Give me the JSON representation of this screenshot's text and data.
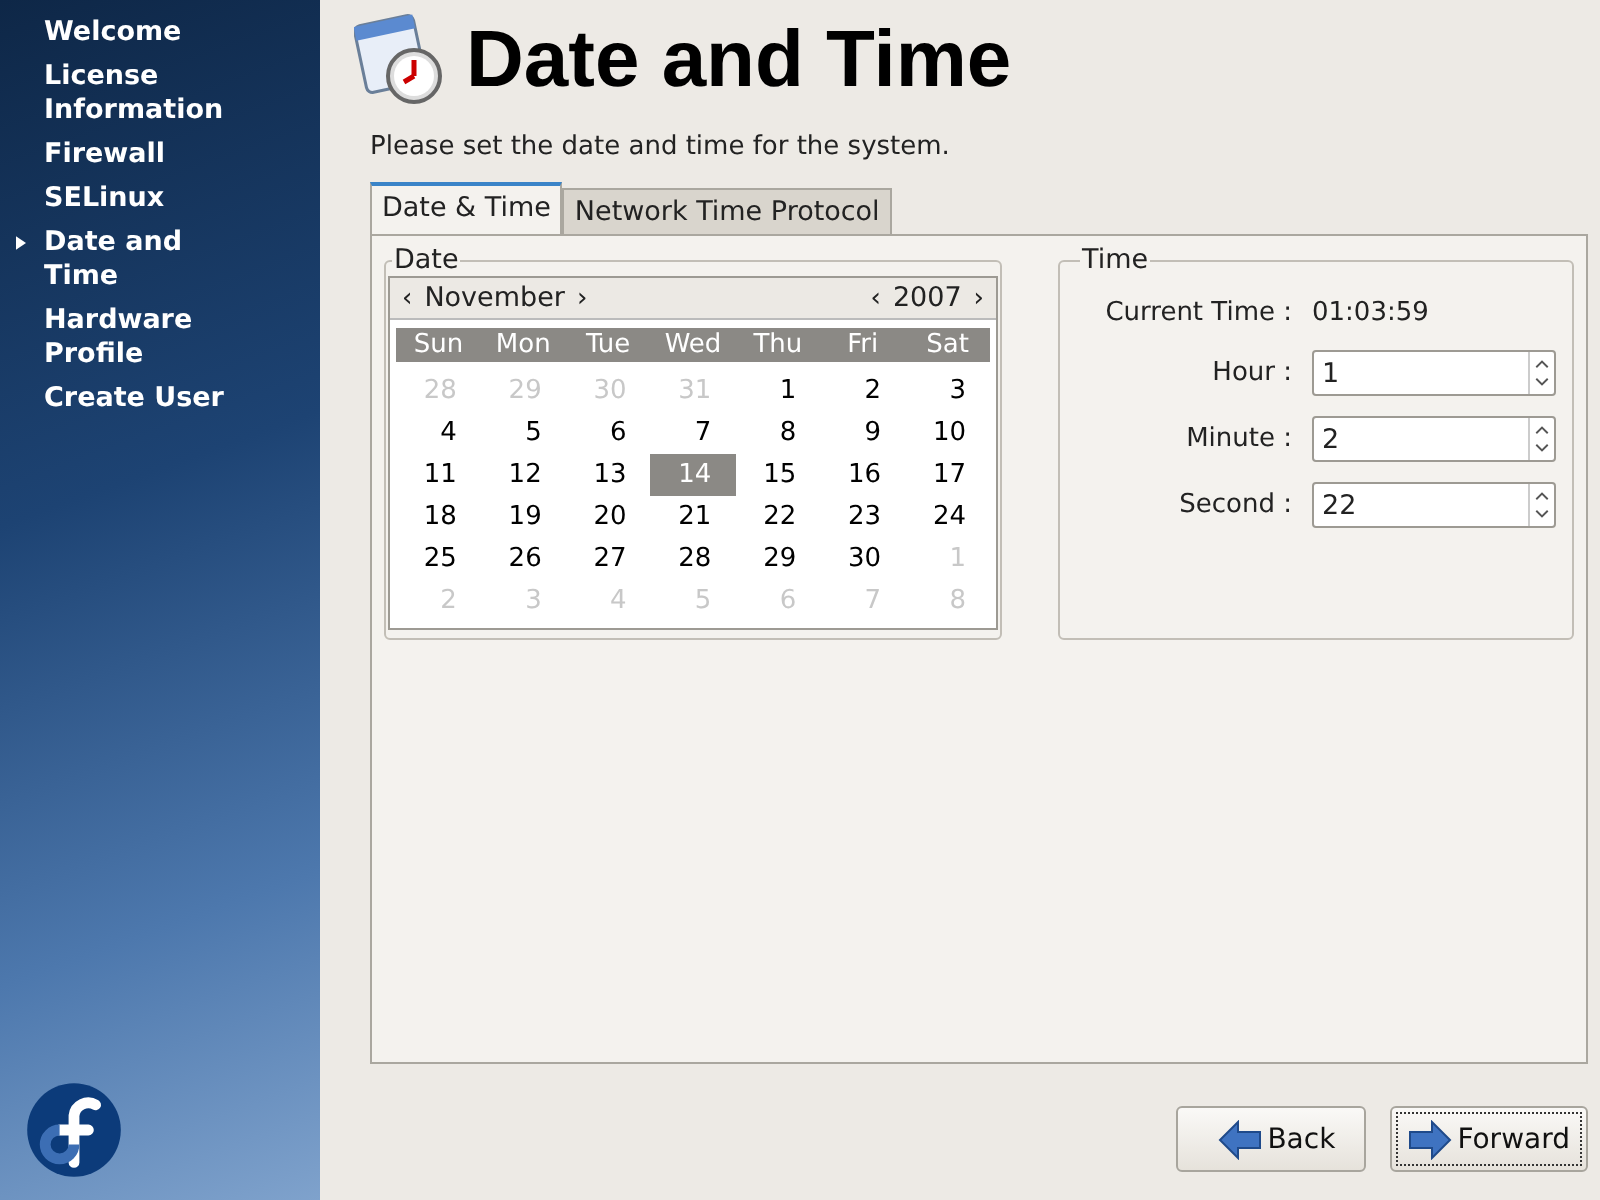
{
  "sidebar": {
    "items": [
      {
        "label": "Welcome",
        "selected": false
      },
      {
        "label": "License Information",
        "selected": false
      },
      {
        "label": "Firewall",
        "selected": false
      },
      {
        "label": "SELinux",
        "selected": false
      },
      {
        "label": "Date and Time",
        "selected": true
      },
      {
        "label": "Hardware Profile",
        "selected": false
      },
      {
        "label": "Create User",
        "selected": false
      }
    ]
  },
  "header": {
    "title": "Date and Time",
    "subtitle": "Please set the date and time for the system."
  },
  "tabs": [
    {
      "label": "Date & Time",
      "selected": true
    },
    {
      "label": "Network Time Protocol",
      "selected": false
    }
  ],
  "date": {
    "legend": "Date",
    "prev_month": "‹",
    "month": "November",
    "next_month": "›",
    "prev_year": "‹",
    "year": "2007",
    "next_year": "›",
    "weekdays": [
      "Sun",
      "Mon",
      "Tue",
      "Wed",
      "Thu",
      "Fri",
      "Sat"
    ],
    "weeks": [
      [
        {
          "day": "28",
          "outside": true,
          "selected": false
        },
        {
          "day": "29",
          "outside": true,
          "selected": false
        },
        {
          "day": "30",
          "outside": true,
          "selected": false
        },
        {
          "day": "31",
          "outside": true,
          "selected": false
        },
        {
          "day": "1",
          "outside": false,
          "selected": false
        },
        {
          "day": "2",
          "outside": false,
          "selected": false
        },
        {
          "day": "3",
          "outside": false,
          "selected": false
        }
      ],
      [
        {
          "day": "4",
          "outside": false,
          "selected": false
        },
        {
          "day": "5",
          "outside": false,
          "selected": false
        },
        {
          "day": "6",
          "outside": false,
          "selected": false
        },
        {
          "day": "7",
          "outside": false,
          "selected": false
        },
        {
          "day": "8",
          "outside": false,
          "selected": false
        },
        {
          "day": "9",
          "outside": false,
          "selected": false
        },
        {
          "day": "10",
          "outside": false,
          "selected": false
        }
      ],
      [
        {
          "day": "11",
          "outside": false,
          "selected": false
        },
        {
          "day": "12",
          "outside": false,
          "selected": false
        },
        {
          "day": "13",
          "outside": false,
          "selected": false
        },
        {
          "day": "14",
          "outside": false,
          "selected": true
        },
        {
          "day": "15",
          "outside": false,
          "selected": false
        },
        {
          "day": "16",
          "outside": false,
          "selected": false
        },
        {
          "day": "17",
          "outside": false,
          "selected": false
        }
      ],
      [
        {
          "day": "18",
          "outside": false,
          "selected": false
        },
        {
          "day": "19",
          "outside": false,
          "selected": false
        },
        {
          "day": "20",
          "outside": false,
          "selected": false
        },
        {
          "day": "21",
          "outside": false,
          "selected": false
        },
        {
          "day": "22",
          "outside": false,
          "selected": false
        },
        {
          "day": "23",
          "outside": false,
          "selected": false
        },
        {
          "day": "24",
          "outside": false,
          "selected": false
        }
      ],
      [
        {
          "day": "25",
          "outside": false,
          "selected": false
        },
        {
          "day": "26",
          "outside": false,
          "selected": false
        },
        {
          "day": "27",
          "outside": false,
          "selected": false
        },
        {
          "day": "28",
          "outside": false,
          "selected": false
        },
        {
          "day": "29",
          "outside": false,
          "selected": false
        },
        {
          "day": "30",
          "outside": false,
          "selected": false
        },
        {
          "day": "1",
          "outside": true,
          "selected": false
        }
      ],
      [
        {
          "day": "2",
          "outside": true,
          "selected": false
        },
        {
          "day": "3",
          "outside": true,
          "selected": false
        },
        {
          "day": "4",
          "outside": true,
          "selected": false
        },
        {
          "day": "5",
          "outside": true,
          "selected": false
        },
        {
          "day": "6",
          "outside": true,
          "selected": false
        },
        {
          "day": "7",
          "outside": true,
          "selected": false
        },
        {
          "day": "8",
          "outside": true,
          "selected": false
        }
      ]
    ]
  },
  "time": {
    "legend": "Time",
    "current_label": "Current Time :",
    "current_value": "01:03:59",
    "fields": [
      {
        "label": "Hour :",
        "value": "1"
      },
      {
        "label": "Minute :",
        "value": "2"
      },
      {
        "label": "Second :",
        "value": "22"
      }
    ]
  },
  "buttons": [
    {
      "label": "Back",
      "kind": "back"
    },
    {
      "label": "Forward",
      "kind": "forward"
    }
  ]
}
